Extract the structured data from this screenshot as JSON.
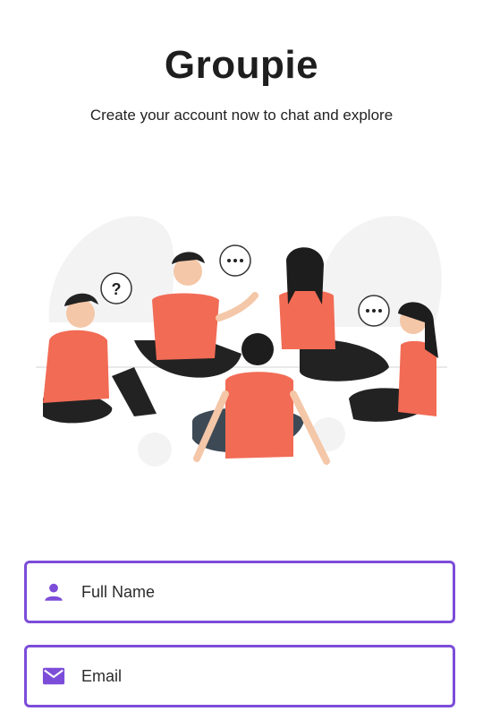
{
  "app": {
    "title": "Groupie",
    "subtitle": "Create your account now to chat and explore"
  },
  "illustration": {
    "name": "group-chat-people"
  },
  "form": {
    "full_name": {
      "placeholder": "Full Name",
      "value": "",
      "icon": "person-icon"
    },
    "email": {
      "placeholder": "Email",
      "value": "",
      "icon": "mail-icon"
    }
  },
  "colors": {
    "accent": "#7c4dd8",
    "shirt": "#f26b55"
  }
}
